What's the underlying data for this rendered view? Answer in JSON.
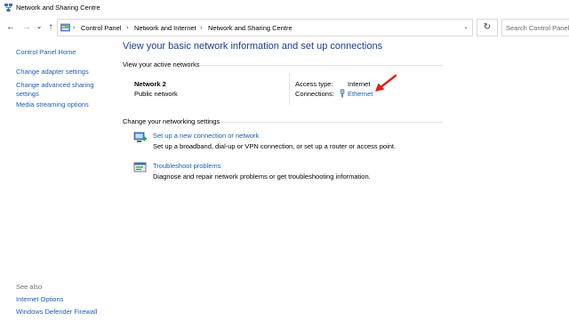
{
  "window": {
    "title": "Network and Sharing Centre"
  },
  "nav": {
    "back": "←",
    "forward": "→",
    "recent": "⌄",
    "up": "↑",
    "breadcrumbs": [
      "Control Panel",
      "Network and Internet",
      "Network and Sharing Centre"
    ],
    "separator": "›",
    "dropdown": "⌄",
    "refresh": "↻",
    "search_placeholder": "Search Control Panel"
  },
  "sidebar": {
    "items": [
      {
        "label": "Control Panel Home"
      },
      {
        "label": "Change adapter settings"
      },
      {
        "label": "Change advanced sharing settings"
      },
      {
        "label": "Media streaming options"
      }
    ],
    "see_also_label": "See also",
    "see_also": [
      {
        "label": "Internet Options"
      },
      {
        "label": "Windows Defender Firewall"
      }
    ]
  },
  "main": {
    "title": "View your basic network information and set up connections",
    "active_networks_label": "View your active networks",
    "network": {
      "name": "Network 2",
      "type": "Public network",
      "access_type_label": "Access type:",
      "access_type_value": "Internet",
      "connections_label": "Connections:",
      "connections_value": "Ethernet"
    },
    "settings_label": "Change your networking settings",
    "tasks": [
      {
        "title": "Set up a new connection or network",
        "description": "Set up a broadband, dial-up or VPN connection, or set up a router or access point."
      },
      {
        "title": "Troubleshoot problems",
        "description": "Diagnose and repair network problems or get troubleshooting information."
      }
    ]
  },
  "colors": {
    "link": "#1a5fb4",
    "title": "#1e3c8c",
    "annotation_arrow": "#e0201b"
  }
}
